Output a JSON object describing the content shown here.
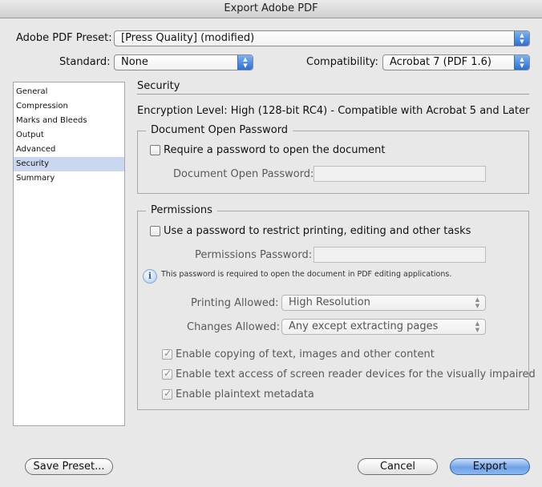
{
  "window": {
    "title": "Export Adobe PDF"
  },
  "preset": {
    "label": "Adobe PDF Preset:",
    "value": "[Press Quality] (modified)"
  },
  "standard": {
    "label": "Standard:",
    "value": "None"
  },
  "compatibility": {
    "label": "Compatibility:",
    "value": "Acrobat 7 (PDF 1.6)"
  },
  "sidebar": {
    "items": [
      {
        "label": "General"
      },
      {
        "label": "Compression"
      },
      {
        "label": "Marks and Bleeds"
      },
      {
        "label": "Output"
      },
      {
        "label": "Advanced"
      },
      {
        "label": "Security",
        "selected": true
      },
      {
        "label": "Summary"
      }
    ]
  },
  "panel": {
    "title": "Security",
    "encryption": "Encryption Level: High (128-bit RC4) - Compatible with Acrobat 5 and Later"
  },
  "open_password": {
    "legend": "Document Open Password",
    "checkbox_label": "Require a password to open the document",
    "field_label": "Document Open Password:",
    "field_value": ""
  },
  "permissions": {
    "legend": "Permissions",
    "checkbox_label": "Use a password to restrict printing, editing and other tasks",
    "field_label": "Permissions Password:",
    "field_value": "",
    "info": "This password is required to open the document in PDF editing applications.",
    "printing_label": "Printing Allowed:",
    "printing_value": "High Resolution",
    "changes_label": "Changes Allowed:",
    "changes_value": "Any except extracting pages",
    "opt_copy": "Enable copying of text, images and other content",
    "opt_screen_reader": "Enable text access of screen reader devices for the visually impaired",
    "opt_metadata": "Enable plaintext metadata"
  },
  "buttons": {
    "save_preset": "Save Preset...",
    "cancel": "Cancel",
    "export": "Export"
  },
  "icons": {
    "checkmark": "✓",
    "info": "i",
    "arrows": "▲▼"
  },
  "colors": {
    "selection": "#c9d8f0",
    "accent": "#2a6fd8"
  }
}
